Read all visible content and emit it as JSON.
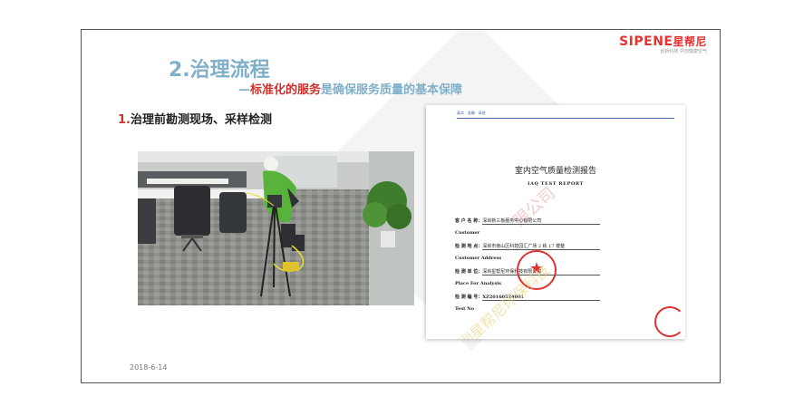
{
  "logo": {
    "brand": "SIPENE",
    "brand_cn": "星帮尼",
    "tagline": "创新科技 共创健康空气"
  },
  "title": "2.治理流程",
  "subtitle": {
    "dash": "—",
    "emphasis": "标准化的服务",
    "rest": "是确保服务质量的基本保障"
  },
  "section": {
    "number": "1.",
    "text": "治理前勘测现场、采样检测"
  },
  "report": {
    "top_line": "真实 · 准确 · 高效",
    "title": "室内空气质量检测报告",
    "subtitle": "IAQ    TEST    REPORT",
    "fields": [
      {
        "label": "客 户 名 称：",
        "value": "深圳新三板服务中心有限公司"
      },
      {
        "label": "Customer",
        "value": ""
      },
      {
        "label": "检 测 地 点：",
        "value": "深圳市南山区科技园汇广场 2 栋 17 楼整"
      },
      {
        "label": "Customer    Address",
        "value": ""
      },
      {
        "label": "检 测 单 位：",
        "value": "深圳星帮尼环保科技有限公司"
      },
      {
        "label": "Place    For    Analysis",
        "value": ""
      },
      {
        "label": "检 测 编 号：",
        "value": "XZ20160524001"
      },
      {
        "label": "Test    No",
        "value": ""
      }
    ],
    "watermark_a": "限公司",
    "watermark_b": "圳星帮尼环保科技"
  },
  "date": "2018-6-14",
  "colors": {
    "title": "#7fb0c8",
    "accent": "#d0302c",
    "report_line": "#4b63a8"
  }
}
